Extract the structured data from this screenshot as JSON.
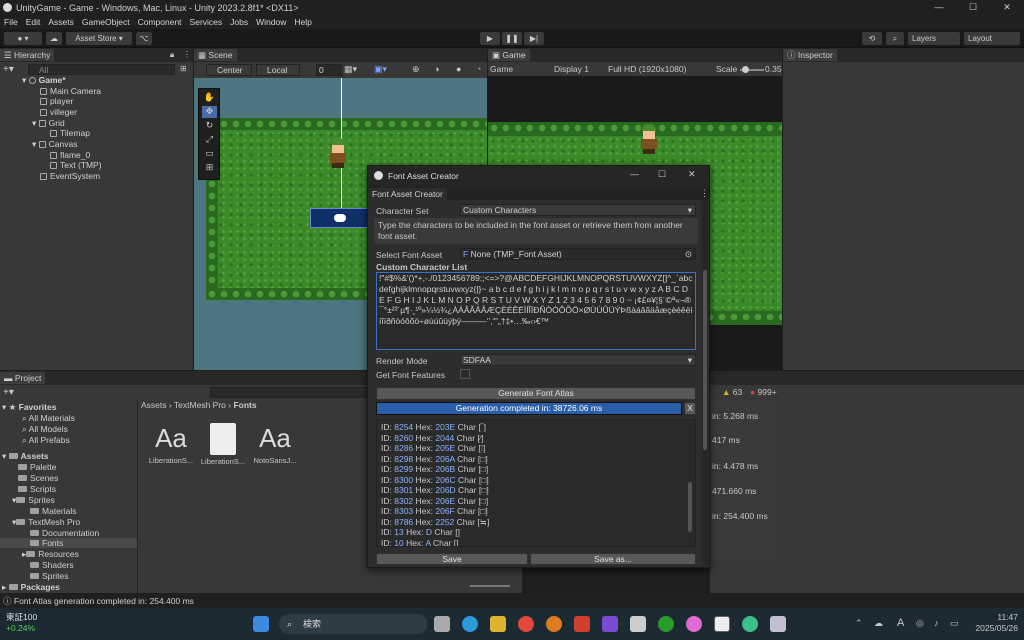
{
  "window": {
    "title": "UnityGame - Game - Windows, Mac, Linux - Unity 2023.2.8f1* <DX11>",
    "controls": [
      "—",
      "☐",
      "✕"
    ]
  },
  "menubar": [
    "File",
    "Edit",
    "Assets",
    "GameObject",
    "Component",
    "Services",
    "Jobs",
    "Window",
    "Help"
  ],
  "toolbar": {
    "asset_store": "Asset Store ▾",
    "layers": "Layers",
    "layout": "Layout"
  },
  "hierarchy": {
    "tab": "Hierarchy",
    "search_placeholder": "All",
    "items": [
      "Game*",
      "Main Camera",
      "player",
      "villeger",
      "Grid",
      "Tilemap",
      "Canvas",
      "flame_0",
      "Text (TMP)",
      "EventSystem"
    ]
  },
  "scene": {
    "tab": "Scene",
    "pivot": "Center",
    "space": "Local",
    "snap_value": "0"
  },
  "game": {
    "tab": "Game",
    "view": "Game",
    "display": "Display 1",
    "resolution": "Full HD (1920x1080)",
    "scale_label": "Scale",
    "scale_value": "0.35"
  },
  "inspector": {
    "tab": "Inspector"
  },
  "project": {
    "tab": "Project",
    "favorites_label": "Favorites",
    "favorites": [
      "All Materials",
      "All Models",
      "All Prefabs"
    ],
    "assets_label": "Assets",
    "assets_tree": [
      "Palette",
      "Scenes",
      "Scripts",
      "Sprites",
      "Materials",
      "TextMesh Pro",
      "Documentation",
      "Fonts",
      "Resources",
      "Shaders",
      "Sprites"
    ],
    "packages_label": "Packages",
    "breadcrumb": [
      "Assets",
      "TextMesh Pro",
      "Fonts"
    ],
    "files": [
      {
        "label": "LiberationS...",
        "kind": "Aa"
      },
      {
        "label": "LiberationS...",
        "kind": "doc"
      },
      {
        "label": "NotoSansJ...",
        "kind": "Aa"
      }
    ]
  },
  "console_peek": {
    "counts": [
      "63",
      "999+"
    ],
    "lines": [
      "in: 5.268 ms",
      "417 ms",
      "in: 4.478 ms",
      "471.660 ms",
      "in: 254.400 ms"
    ]
  },
  "dialog": {
    "title": "Font Asset Creator",
    "tab": "Font Asset Creator",
    "character_set_label": "Character Set",
    "character_set_value": "Custom Characters",
    "help_text": "Type the characters to be included in the font asset or retrieve them from another font asset.",
    "select_font_asset_label": "Select Font Asset",
    "select_font_asset_value": "None (TMP_Font Asset)",
    "custom_list_label": "Custom Character List",
    "custom_list_text": "!\"#$%&'()*+,-./0123456789:;<=>?@ABCDEFGHIJKLMNOPQRSTUVWXYZ[]^_`abcdefghijklmnopqrstuvwxyz{|}~ a b c d e f g h i j k l m n o p q r s t u v w x y z A B C D E F G H I J K L M N O P Q R S T U V W X Y Z 1 2 3 4 5 6 7 8 9 0 ~ ¡¢£¤¥¦§¨©ª«¬®¯°±²³´µ¶·¸¹º»¼½¾¿ÀÁÂÃÄÅÆÇÈÉÊËÌÍÎÏÐÑÒÓÔÕÖ×ØÙÚÛÜÝÞßàáâãäåæçèéêëìíîïðñòóôõö÷øùúûüýþÿ———‘’‚“”„†‡•…‰‹›€™",
    "render_mode_label": "Render Mode",
    "render_mode_value": "SDFAA",
    "get_features_label": "Get Font Features",
    "generate_button": "Generate Font Atlas",
    "progress_text": "Generation completed in: 38726.06 ms",
    "progress_fraction": 1.0,
    "log": [
      {
        "id": "8254",
        "hex": "203E",
        "ch": "‾"
      },
      {
        "id": "8260",
        "hex": "2044",
        "ch": "⁄"
      },
      {
        "id": "8286",
        "hex": "205E",
        "ch": "⁞"
      },
      {
        "id": "8298",
        "hex": "206A",
        "ch": "□"
      },
      {
        "id": "8299",
        "hex": "206B",
        "ch": "□"
      },
      {
        "id": "8300",
        "hex": "206C",
        "ch": "□"
      },
      {
        "id": "8301",
        "hex": "206D",
        "ch": "□"
      },
      {
        "id": "8302",
        "hex": "206E",
        "ch": "□"
      },
      {
        "id": "8303",
        "hex": "206F",
        "ch": "□"
      },
      {
        "id": "8786",
        "hex": "2252",
        "ch": "≒"
      },
      {
        "id": "13",
        "hex": "D",
        "ch": ""
      },
      {
        "id": "10",
        "hex": "A",
        "ch": ""
      }
    ],
    "log_tail": "]",
    "save_button": "Save",
    "save_as_button": "Save as..."
  },
  "status": {
    "text": "Font Atlas generation completed in: 254.400 ms"
  },
  "taskbar": {
    "stock_name": "東証100",
    "stock_change": "+0.24%",
    "search": "検索",
    "time": "11:47",
    "date": "2025/05/26",
    "ime": "A"
  }
}
